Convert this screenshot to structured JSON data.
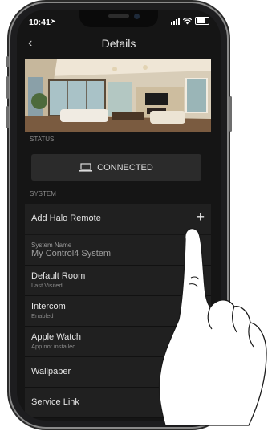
{
  "status_bar": {
    "time": "10:41"
  },
  "nav": {
    "title": "Details",
    "back_icon": "chevron-left-icon"
  },
  "sections": {
    "status": "STATUS",
    "system": "SYSTEM"
  },
  "connection": {
    "label": "CONNECTED",
    "icon": "laptop-icon"
  },
  "rows": {
    "add_remote": {
      "label": "Add Halo Remote",
      "action": "+"
    },
    "system_name": {
      "label": "System Name",
      "value": "My Control4 System"
    },
    "default_room": {
      "label": "Default Room",
      "sub": "Last Visited"
    },
    "intercom": {
      "label": "Intercom",
      "sub": "Enabled"
    },
    "apple_watch": {
      "label": "Apple Watch",
      "sub": "App not installed"
    },
    "wallpaper": {
      "label": "Wallpaper"
    },
    "service_link": {
      "label": "Service Link"
    }
  },
  "colors": {
    "background": "#151515",
    "row": "#202020",
    "card": "#2b2b2b"
  }
}
